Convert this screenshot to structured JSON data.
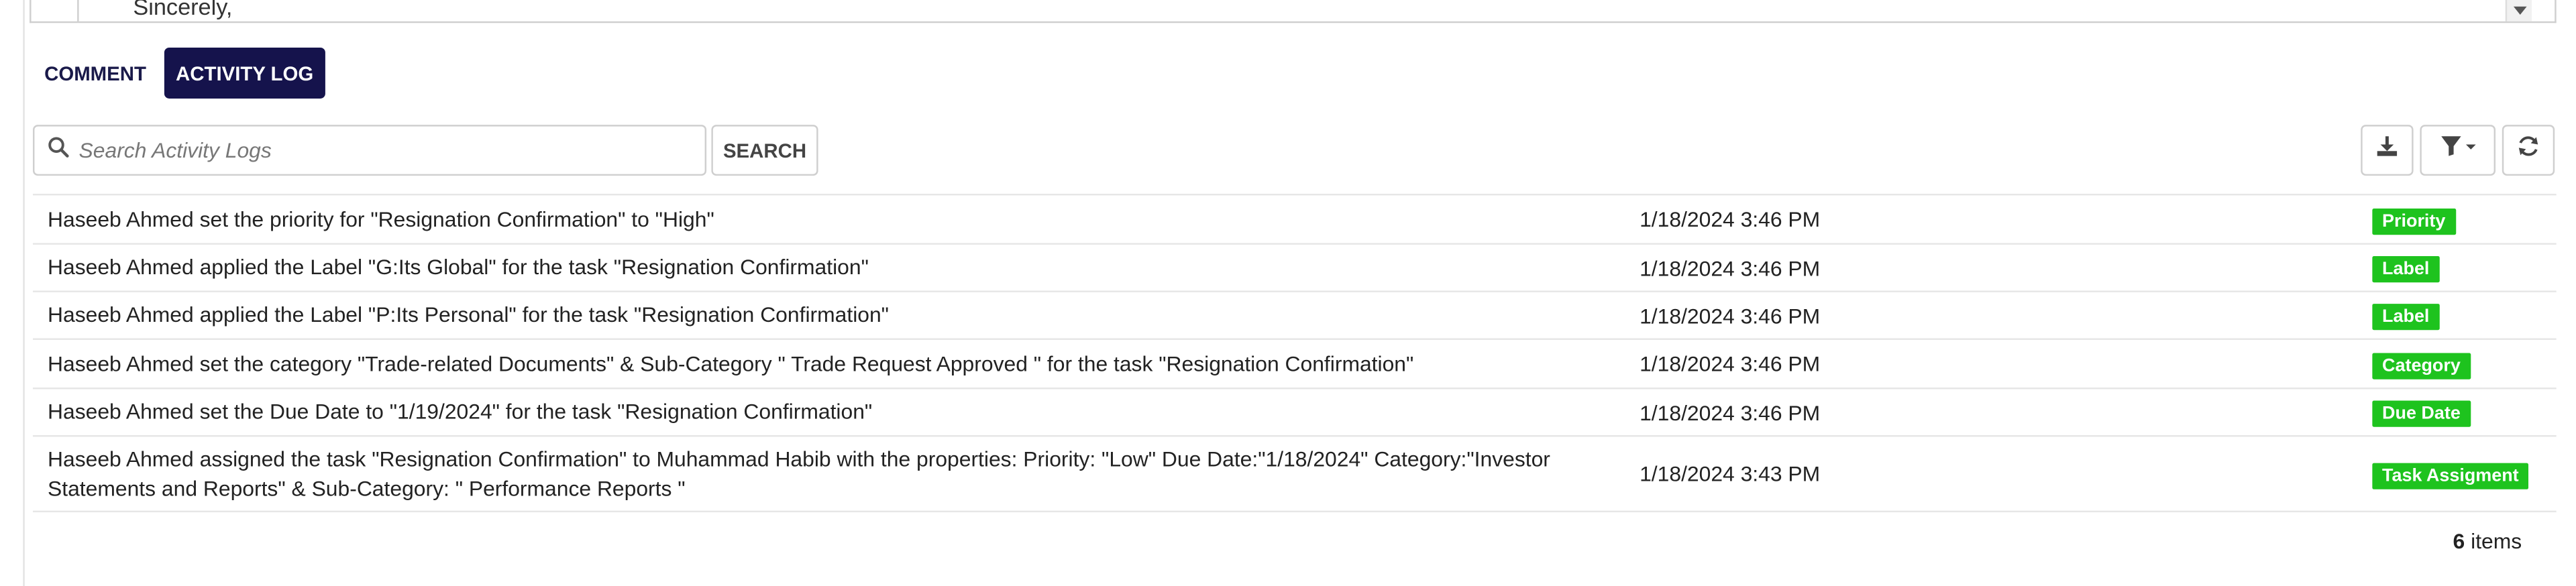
{
  "editor": {
    "text": "Sincerely,"
  },
  "tabs": [
    {
      "label": "COMMENT"
    },
    {
      "label": "ACTIVITY LOG"
    }
  ],
  "search": {
    "placeholder": "Search Activity Logs",
    "value": "",
    "button_label": "SEARCH"
  },
  "toolbar": {
    "download_icon": "download-icon",
    "filter_icon": "filter-icon",
    "refresh_icon": "refresh-icon"
  },
  "colors": {
    "active_tab": "#15134c",
    "badge": "#1ec31e"
  },
  "logs": [
    {
      "message": "Haseeb Ahmed set the priority for \"Resignation Confirmation\" to \"High\"",
      "time": "1/18/2024 3:46 PM",
      "tag": "Priority"
    },
    {
      "message": "Haseeb Ahmed applied the Label \"G:Its Global\" for the task \"Resignation Confirmation\"",
      "time": "1/18/2024 3:46 PM",
      "tag": "Label"
    },
    {
      "message": "Haseeb Ahmed applied the Label \"P:Its Personal\" for the task \"Resignation Confirmation\"",
      "time": "1/18/2024 3:46 PM",
      "tag": "Label"
    },
    {
      "message": "Haseeb Ahmed set the category \"Trade-related Documents\" & Sub-Category \" Trade Request Approved \" for the task \"Resignation Confirmation\"",
      "time": "1/18/2024 3:46 PM",
      "tag": "Category"
    },
    {
      "message": "Haseeb Ahmed set the Due Date to \"1/19/2024\" for the task \"Resignation Confirmation\"",
      "time": "1/18/2024 3:46 PM",
      "tag": "Due Date"
    },
    {
      "message": "Haseeb Ahmed assigned the task \"Resignation Confirmation\" to Muhammad Habib with the properties: Priority: \"Low\" Due Date:\"1/18/2024\" Category:\"Investor Statements and Reports\" & Sub-Category: \" Performance Reports  \"",
      "time": "1/18/2024 3:43 PM",
      "tag": "Task Assigment"
    }
  ],
  "pager": {
    "count": "6",
    "label": "items"
  }
}
